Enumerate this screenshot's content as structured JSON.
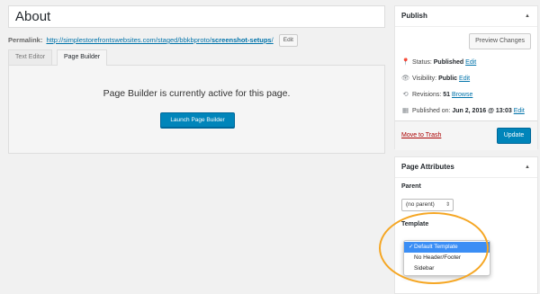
{
  "title_field": {
    "value": "About"
  },
  "permalink": {
    "label": "Permalink:",
    "url_base": "http://simplestorefrontswebsites.com/staged/bbkbproto/",
    "slug": "screenshot-setups",
    "url_end": "/",
    "edit_label": "Edit"
  },
  "tabs": {
    "text_editor": "Text Editor",
    "page_builder": "Page Builder"
  },
  "builder": {
    "message": "Page Builder is currently active for this page.",
    "launch_label": "Launch Page Builder"
  },
  "publish": {
    "title": "Publish",
    "toggle_glyph": "▲",
    "preview_label": "Preview Changes",
    "status_label": "Status:",
    "status_value": "Published",
    "visibility_label": "Visibility:",
    "visibility_value": "Public",
    "revisions_label": "Revisions:",
    "revisions_value": "51",
    "browse_label": "Browse",
    "published_label": "Published on:",
    "published_value": "Jun 2, 2016 @ 13:03",
    "edit_label": "Edit",
    "trash_label": "Move to Trash",
    "update_label": "Update"
  },
  "attributes": {
    "title": "Page Attributes",
    "toggle_glyph": "▲",
    "parent_label": "Parent",
    "parent_value": "(no parent)",
    "template_label": "Template",
    "template_options": [
      "Default Template",
      "No Header/Footer",
      "Sidebar"
    ],
    "selected_mark": "✓"
  },
  "icons": {
    "status": "pin-icon",
    "visibility": "eye-icon",
    "revisions": "history-icon",
    "published": "calendar-icon"
  },
  "colors": {
    "accent": "#0085ba",
    "link": "#0073aa",
    "trash": "#aa0000",
    "highlight": "#f5a623",
    "menu_selected": "#3b8ef5"
  }
}
